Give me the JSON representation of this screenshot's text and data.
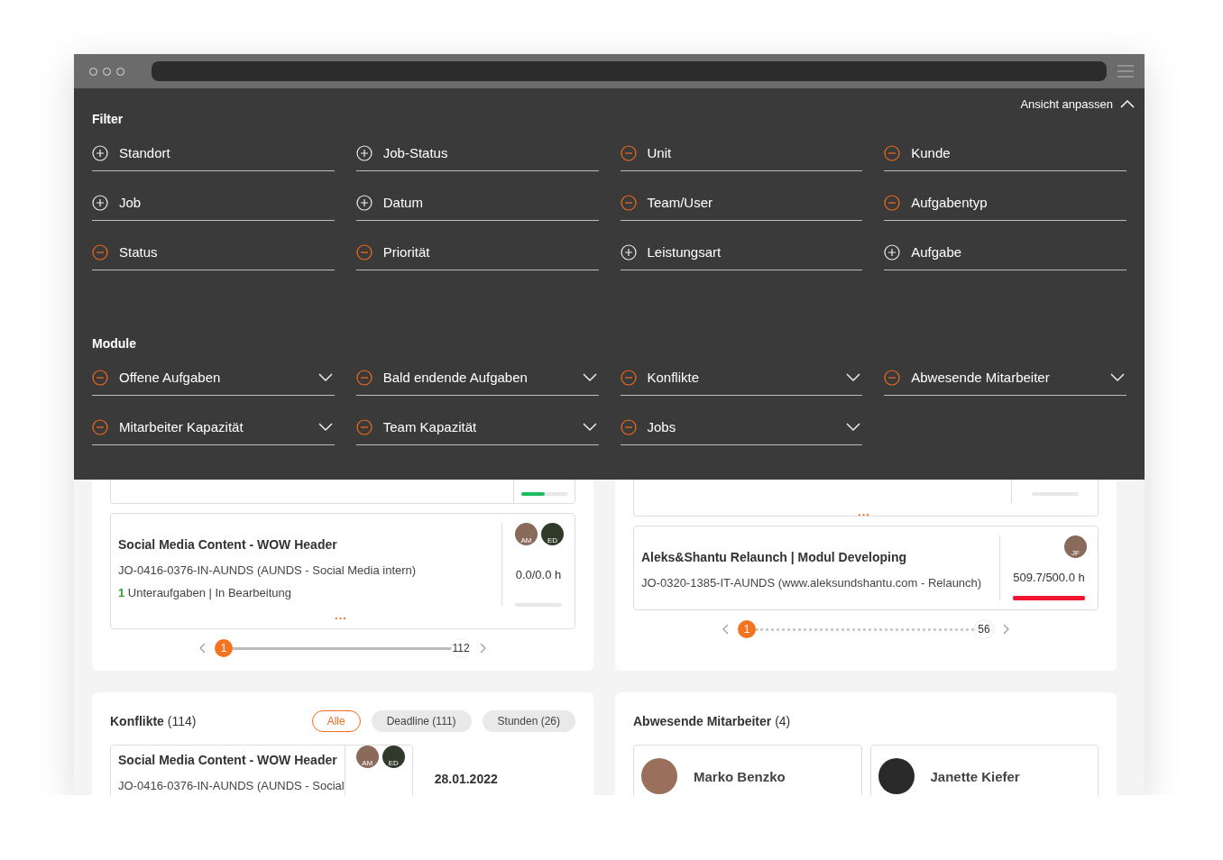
{
  "overlay": {
    "toggle": {
      "label": "Ansicht anpassen",
      "expanded": true
    },
    "filter": {
      "title": "Filter",
      "items": [
        {
          "label": "Standort",
          "kind": "add"
        },
        {
          "label": "Job-Status",
          "kind": "add"
        },
        {
          "label": "Unit",
          "kind": "remove"
        },
        {
          "label": "Kunde",
          "kind": "remove"
        },
        {
          "label": "Job",
          "kind": "add"
        },
        {
          "label": "Datum",
          "kind": "add"
        },
        {
          "label": "Team/User",
          "kind": "remove"
        },
        {
          "label": "Aufgabentyp",
          "kind": "remove"
        },
        {
          "label": "Status",
          "kind": "remove"
        },
        {
          "label": "Priorität",
          "kind": "remove"
        },
        {
          "label": "Leistungsart",
          "kind": "add"
        },
        {
          "label": "Aufgabe",
          "kind": "add"
        }
      ]
    },
    "module": {
      "title": "Module",
      "items": [
        {
          "label": "Offene Aufgaben",
          "kind": "remove"
        },
        {
          "label": "Bald endende Aufgaben",
          "kind": "remove"
        },
        {
          "label": "Konflikte",
          "kind": "remove"
        },
        {
          "label": "Abwesende Mitarbeiter",
          "kind": "remove"
        },
        {
          "label": "Mitarbeiter Kapazität",
          "kind": "remove"
        },
        {
          "label": "Team Kapazität",
          "kind": "remove"
        },
        {
          "label": "Jobs",
          "kind": "remove"
        }
      ]
    }
  },
  "content": {
    "left_panel": {
      "fragment": {
        "level": 0.5,
        "over": false
      },
      "cards": [
        {
          "title": "Social Media Content - WOW Header",
          "reference": "JO-0416-0376-IN-AUNDS (AUNDS - Social Media intern)",
          "status": "**1** Unteraufgaben | In Bearbeitung",
          "avatars": [
            "AM",
            "ED"
          ],
          "hours": "0.0/0.0 h",
          "level": 0,
          "more": "..."
        }
      ],
      "pager": {
        "kind": "solid",
        "level": 0,
        "current": "1",
        "last": "112"
      }
    },
    "right_panel": {
      "fragment": {
        "level": 0,
        "more": "..."
      },
      "cards": [
        {
          "title": "Aleks&Shantu Relaunch | Modul Developing",
          "reference": "JO-0320-1385-IT-AUNDS (www.aleksundshantu.com - Relaunch)",
          "avatars": [
            "JF"
          ],
          "hours": "509.7/500.0 h",
          "level": 1,
          "over": true
        }
      ],
      "pager": {
        "kind": "dotted",
        "level": 0,
        "current": "1",
        "last": "56"
      }
    },
    "conflicts": {
      "title": "**Konflikte** (114)",
      "chips": [
        {
          "label": "Alle",
          "selected": true
        },
        {
          "label": "Deadline (111)",
          "selected": false
        },
        {
          "label": "Stunden (26)",
          "selected": false
        }
      ],
      "card": {
        "title": "Social Media Content - WOW Header",
        "reference": "JO-0416-0376-IN-AUNDS (AUNDS - Social",
        "avatars": [
          "AM",
          "ED"
        ]
      },
      "date": "28.01.2022"
    },
    "absent": {
      "title": "**Abwesende Mitarbeiter** (4)",
      "people": [
        {
          "name": "Marko Benzko"
        },
        {
          "name": "Janette Kiefer"
        }
      ]
    }
  }
}
